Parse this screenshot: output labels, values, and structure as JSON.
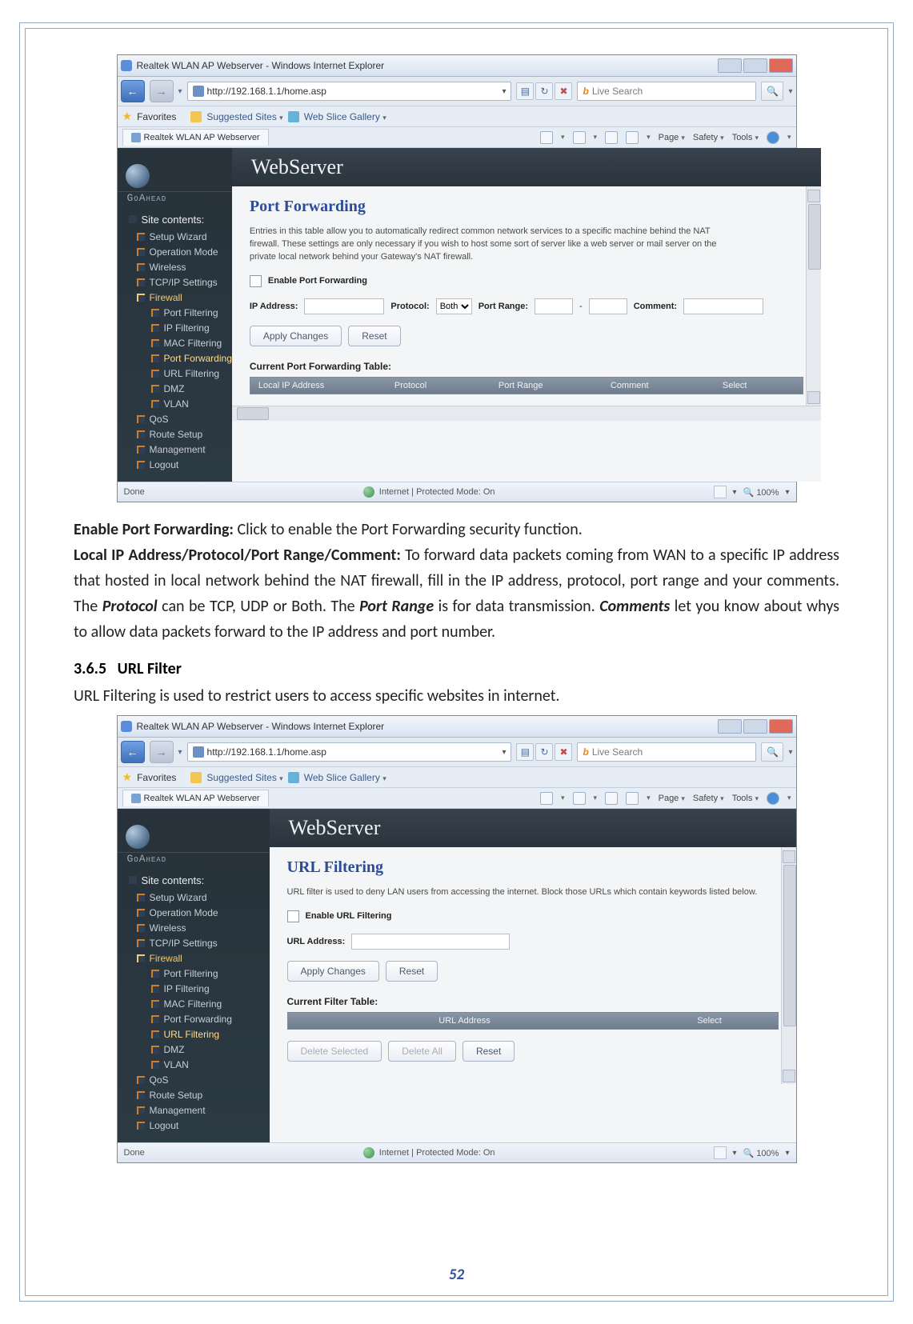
{
  "browser": {
    "window_title": "Realtek WLAN AP Webserver - Windows Internet Explorer",
    "url": "http://192.168.1.1/home.asp",
    "search_placeholder": "Live Search",
    "favorites_label": "Favorites",
    "suggested_sites": "Suggested Sites",
    "web_slice": "Web Slice Gallery",
    "tab_label": "Realtek WLAN AP Webserver",
    "menu": {
      "page": "Page",
      "safety": "Safety",
      "tools": "Tools"
    },
    "status": {
      "done": "Done",
      "zone": "Internet | Protected Mode: On",
      "zoom": "100%"
    }
  },
  "webserver": {
    "banner": "WebServer",
    "brand": "GoAhead",
    "site_contents": "Site contents:",
    "nav": {
      "setup_wizard": "Setup Wizard",
      "operation_mode": "Operation Mode",
      "wireless": "Wireless",
      "tcpip": "TCP/IP Settings",
      "firewall": "Firewall",
      "port_filtering": "Port Filtering",
      "ip_filtering": "IP Filtering",
      "mac_filtering": "MAC Filtering",
      "port_forwarding": "Port Forwarding",
      "url_filtering": "URL Filtering",
      "dmz": "DMZ",
      "vlan": "VLAN",
      "qos": "QoS",
      "route_setup": "Route Setup",
      "management": "Management",
      "logout": "Logout"
    }
  },
  "port_forwarding": {
    "title": "Port Forwarding",
    "desc": "Entries in this table allow you to automatically redirect common network services to a specific machine behind the NAT firewall. These settings are only necessary if you wish to host some sort of server like a web server or mail server on the private local network behind your Gateway's NAT firewall.",
    "enable_label": "Enable Port Forwarding",
    "ip_label": "IP Address:",
    "protocol_label": "Protocol:",
    "protocol_selected": "Both",
    "port_range_label": "Port Range:",
    "port_range_sep": "-",
    "comment_label": "Comment:",
    "apply_btn": "Apply Changes",
    "reset_btn": "Reset",
    "table_title": "Current Port Forwarding Table:",
    "table_headers": {
      "local_ip": "Local IP Address",
      "protocol": "Protocol",
      "port_range": "Port Range",
      "comment": "Comment",
      "select": "Select"
    }
  },
  "url_filtering": {
    "title": "URL Filtering",
    "desc": "URL filter is used to deny LAN users from accessing the internet. Block those URLs which contain keywords listed below.",
    "enable_label": "Enable URL Filtering",
    "url_label": "URL Address:",
    "apply_btn": "Apply Changes",
    "reset_btn": "Reset",
    "table_title": "Current Filter Table:",
    "table_headers": {
      "url": "URL Address",
      "select": "Select"
    },
    "delete_selected": "Delete Selected",
    "delete_all": "Delete All",
    "reset2": "Reset"
  },
  "doc": {
    "p1a": "Enable Port Forwarding:",
    "p1b": " Click to enable the Port Forwarding security function.",
    "p2a": "Local IP Address/Protocol/Port Range/Comment:",
    "p2b": " To forward data packets coming from WAN to a specific IP address that hosted in local network behind the NAT firewall, fill in the IP address, protocol, port range and your comments. The ",
    "p2c": "Protocol",
    "p2d": " can be TCP, UDP or Both. The ",
    "p2e": "Port Range",
    "p2f": " is for data transmission. ",
    "p2g": "Comments",
    "p2h": " let you know about whys to allow data packets forward to the IP address and port number.",
    "section_no": "3.6.5",
    "section_title": "URL Filter",
    "p3": "URL Filtering is used to restrict users to access specific websites in internet.",
    "page_number": "52"
  }
}
